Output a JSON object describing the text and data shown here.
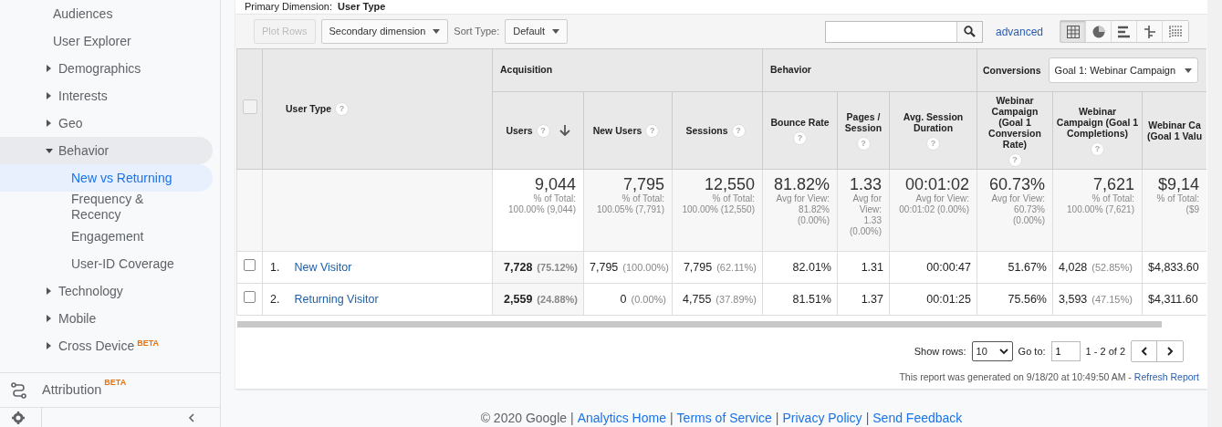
{
  "sidebar": {
    "items": [
      {
        "label": "Audiences",
        "kind": "link",
        "selected": false
      },
      {
        "label": "User Explorer",
        "kind": "link",
        "selected": false
      },
      {
        "label": "Demographics",
        "kind": "group",
        "expanded": false,
        "selected": false
      },
      {
        "label": "Interests",
        "kind": "group",
        "expanded": false,
        "selected": false
      },
      {
        "label": "Geo",
        "kind": "group",
        "expanded": false,
        "selected": false
      },
      {
        "label": "Behavior",
        "kind": "group",
        "expanded": true,
        "selected": false,
        "children": [
          {
            "label": "New vs Returning",
            "kind": "link",
            "selected": true
          },
          {
            "label": "Frequency & Recency",
            "kind": "link",
            "selected": false
          },
          {
            "label": "Engagement",
            "kind": "link",
            "selected": false
          },
          {
            "label": "User-ID Coverage",
            "kind": "link",
            "selected": false
          }
        ]
      },
      {
        "label": "Technology",
        "kind": "group",
        "expanded": false,
        "selected": false
      },
      {
        "label": "Mobile",
        "kind": "group",
        "expanded": false,
        "selected": false
      },
      {
        "label": "Cross Device",
        "kind": "group",
        "expanded": false,
        "selected": false,
        "badge": "BETA"
      }
    ],
    "attribution": {
      "label": "Attribution",
      "badge": "BETA"
    }
  },
  "primary_dimension": {
    "label": "Primary Dimension:",
    "value": "User Type"
  },
  "toolbar": {
    "plot_rows": {
      "label": "Plot Rows",
      "disabled": true
    },
    "secondary_dimension": "Secondary dimension",
    "sort_label": "Sort Type:",
    "sort_value": "Default",
    "advanced": "advanced",
    "views": [
      {
        "kind": "table",
        "selected": true
      },
      {
        "kind": "pie",
        "selected": false
      },
      {
        "kind": "performance",
        "selected": false
      },
      {
        "kind": "comparison",
        "selected": false
      },
      {
        "kind": "pivot",
        "selected": false
      }
    ]
  },
  "table": {
    "select_all": {
      "checked": false
    },
    "dimension": {
      "label": "User Type",
      "help": "?"
    },
    "groups": [
      {
        "label": "Acquisition",
        "columns": [
          {
            "label": "Users",
            "help": "?",
            "sorted": true,
            "total": "9,044",
            "note": "% of Total: 100.00% (9,044)"
          },
          {
            "label": "New Users",
            "help": "?",
            "sorted": false,
            "total": "7,795",
            "note": "% of Total: 100.05% (7,791)"
          },
          {
            "label": "Sessions",
            "help": "?",
            "sorted": false,
            "total": "12,550",
            "note": "% of Total: 100.00% (12,550)"
          }
        ]
      },
      {
        "label": "Behavior",
        "columns": [
          {
            "label": "Bounce Rate",
            "help": "?",
            "sorted": false,
            "total": "81.82%",
            "note": "Avg for View: 81.82% (0.00%)"
          },
          {
            "label": "Pages / Session",
            "help": "?",
            "sorted": false,
            "total": "1.33",
            "note": "Avg for View: 1.33 (0.00%)"
          },
          {
            "label": "Avg. Session Duration",
            "help": "?",
            "sorted": false,
            "total": "00:01:02",
            "note": "Avg for View: 00:01:02 (0.00%)"
          }
        ]
      },
      {
        "label": "Conversions",
        "dropdown": "Goal 1: Webinar Campaign",
        "columns": [
          {
            "label": "Webinar Campaign (Goal 1 Conversion Rate)",
            "help": "?",
            "sorted": false,
            "total": "60.73%",
            "note": "Avg for View: 60.73% (0.00%)"
          },
          {
            "label": "Webinar Campaign (Goal 1 Completions)",
            "help": "?",
            "sorted": false,
            "total": "7,621",
            "note": "% of Total: 100.00% (7,621)"
          },
          {
            "label": "Webinar Ca (Goal 1 Valu",
            "sorted": false,
            "total": "$9,14",
            "note": "% of Total: ($9"
          }
        ]
      }
    ],
    "rows": [
      {
        "index": "1.",
        "label": "New Visitor",
        "checked": false,
        "cells": [
          {
            "value": "7,728",
            "pct": "(75.12%)"
          },
          {
            "value": "7,795",
            "pct": "(100.00%)"
          },
          {
            "value": "7,795",
            "pct": "(62.11%)"
          },
          {
            "value": "82.01%"
          },
          {
            "value": "1.31"
          },
          {
            "value": "00:00:47"
          },
          {
            "value": "51.67%"
          },
          {
            "value": "4,028",
            "pct": "(52.85%)"
          },
          {
            "value": "$4,833.60"
          }
        ]
      },
      {
        "index": "2.",
        "label": "Returning Visitor",
        "checked": false,
        "cells": [
          {
            "value": "2,559",
            "pct": "(24.88%)"
          },
          {
            "value": "0",
            "pct": "(0.00%)"
          },
          {
            "value": "4,755",
            "pct": "(37.89%)"
          },
          {
            "value": "81.51%"
          },
          {
            "value": "1.37"
          },
          {
            "value": "00:01:25"
          },
          {
            "value": "75.56%"
          },
          {
            "value": "3,593",
            "pct": "(47.15%)"
          },
          {
            "value": "$4,311.60"
          }
        ]
      }
    ]
  },
  "pagination": {
    "show_rows_label": "Show rows:",
    "show_rows": "10",
    "goto_label": "Go to:",
    "goto": "1",
    "range": "1 - 2 of 2"
  },
  "generated": {
    "text": "This report was generated on 9/18/20 at 10:49:50 AM - ",
    "link": "Refresh Report"
  },
  "footer": {
    "separator": "|",
    "items": [
      {
        "kind": "text",
        "text": "© 2020 Google"
      },
      {
        "kind": "link",
        "text": "Analytics Home"
      },
      {
        "kind": "link",
        "text": "Terms of Service"
      },
      {
        "kind": "link",
        "text": "Privacy Policy"
      },
      {
        "kind": "link",
        "text": "Send Feedback"
      }
    ]
  }
}
